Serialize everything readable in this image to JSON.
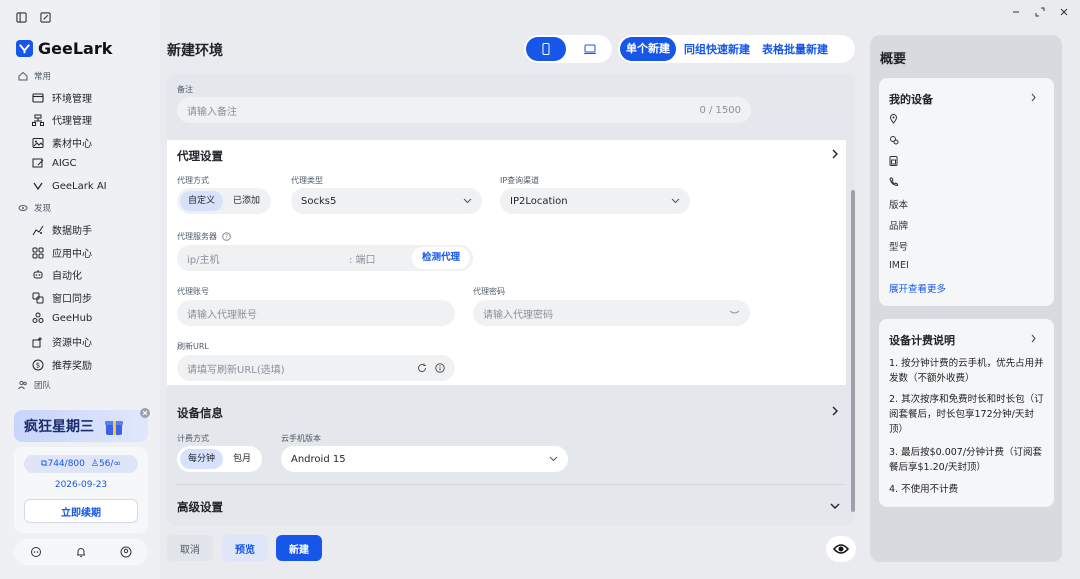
{
  "app": {
    "logo_text": "GeeLark",
    "window_controls": [
      "minimize",
      "restore",
      "close"
    ]
  },
  "sidebar": {
    "group_common": "常用",
    "items_common": [
      {
        "label": "环境管理",
        "icon": "browser-window-icon"
      },
      {
        "label": "代理管理",
        "icon": "network-icon"
      },
      {
        "label": "素材中心",
        "icon": "image-folder-icon"
      },
      {
        "label": "AIGC",
        "icon": "ai-edit-icon"
      },
      {
        "label": "GeeLark AI",
        "icon": "geelark-ai-icon"
      }
    ],
    "group_discover": "发现",
    "items_discover": [
      {
        "label": "数据助手",
        "icon": "data-sparkle-icon"
      },
      {
        "label": "应用中心",
        "icon": "apps-grid-icon"
      },
      {
        "label": "自动化",
        "icon": "robot-icon"
      },
      {
        "label": "窗口同步",
        "icon": "sync-icon"
      },
      {
        "label": "GeeHub",
        "icon": "hub-icon"
      },
      {
        "label": "资源中心",
        "icon": "resource-icon"
      },
      {
        "label": "推荐奖励",
        "icon": "dollar-icon"
      }
    ],
    "group_team": "团队",
    "promo": {
      "banner_text": "疯狂星期三",
      "devices": "744/800",
      "members": "56/∞",
      "date": "2026-09-23",
      "renew_label": "立即续期"
    }
  },
  "header": {
    "title": "新建环境",
    "device_toggle": [
      "phone",
      "desktop"
    ],
    "tabs": [
      "单个新建",
      "同组快速新建",
      "表格批量新建"
    ],
    "active_tab": 0
  },
  "form": {
    "remark": {
      "label": "备注",
      "placeholder": "请输入备注",
      "counter": "0 / 1500"
    },
    "proxy": {
      "title": "代理设置",
      "method_label": "代理方式",
      "method_options": [
        "自定义",
        "已添加"
      ],
      "type_label": "代理类型",
      "type_value": "Socks5",
      "ip_label": "IP查询渠道",
      "ip_value": "IP2Location",
      "server_label": "代理服务器",
      "host_placeholder": "ip/主机",
      "port_placeholder": ": 端口",
      "check_label": "检测代理",
      "account_label": "代理账号",
      "account_placeholder": "请输入代理账号",
      "password_label": "代理密码",
      "password_placeholder": "请输入代理密码",
      "refresh_label": "刷新URL",
      "refresh_placeholder": "请填写刷新URL(选填)"
    },
    "device": {
      "title": "设备信息",
      "billing_label": "计费方式",
      "billing_options": [
        "每分钟",
        "包月"
      ],
      "version_label": "云手机版本",
      "version_value": "Android 15"
    },
    "advanced": {
      "title": "高级设置"
    }
  },
  "footer": {
    "cancel": "取消",
    "preview": "预览",
    "create": "新建"
  },
  "overview": {
    "title": "概要",
    "my_device": {
      "title": "我的设备",
      "rows": [
        "版本",
        "品牌",
        "型号",
        "IMEI"
      ],
      "expand": "展开查看更多"
    },
    "billing": {
      "title": "设备计费说明",
      "items": [
        "1. 按分钟计费的云手机，优先占用并发数（不额外收费）",
        "2. 其次按序和免费时长和时长包（订阅套餐后，时长包享172分钟/天封顶）",
        "3. 最后按$0.007/分钟计费（订阅套餐后享$1.20/天封顶）",
        "4. 不使用不计费"
      ]
    }
  },
  "colors": {
    "accent": "#1656e8",
    "accent_light": "#d7e1fb",
    "bg": "#e9ebee"
  }
}
